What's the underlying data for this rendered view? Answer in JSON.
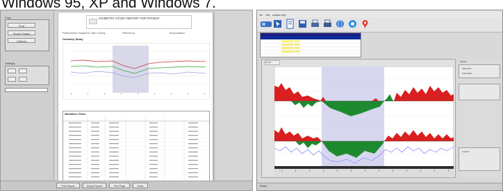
{
  "caption": "Windows 95, XP and Windows 7.",
  "left_window": {
    "sidebar": {
      "group1_label": "Prog",
      "btn_print": "Print",
      "btn_export": "Export Graph",
      "btn_options": "Options",
      "group2_label": "Settings"
    },
    "document": {
      "title": "OXIMETRY STUDY REPORT FOR PATIENT",
      "meta_left": "Patient Name: Hospital ID: Date of Study:",
      "meta_mid": "Referred by:",
      "meta_right": "Study duration:",
      "section": "Oximetry Study",
      "table_title": "Saturation / Pulse"
    },
    "statusbar": [
      "Print Report",
      "Export Report",
      "Print Page",
      "Close"
    ]
  },
  "right_window": {
    "menu": [
      "File",
      "View",
      "Analysis",
      "Help"
    ],
    "toolbar_icons": [
      "wand-icon",
      "cursor-icon",
      "document-icon",
      "save-icon",
      "printer-icon",
      "printer-alt-icon",
      "globe-icon",
      "help-icon",
      "pin-icon"
    ],
    "chart_label": "Graph",
    "side_panel": {
      "title": "Display",
      "option1": "Saturation",
      "option2": "Pulse Rate",
      "legend_title": "Legend"
    },
    "status_left": "Ready"
  },
  "colors": {
    "positive_fill": "#d91f1f",
    "negative_fill": "#1e8a2f",
    "highlight": "#d6d6ef",
    "line_light": "#9999ff"
  }
}
